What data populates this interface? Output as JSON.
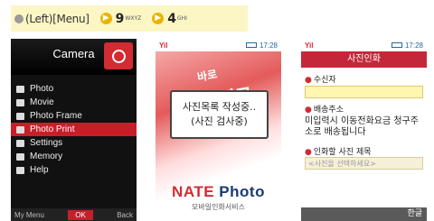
{
  "instruction": {
    "menu_hint": "(Left)[Menu]",
    "key1": "9",
    "key1_sub": "WXYZ",
    "key2": "4",
    "key2_sub": "GHI"
  },
  "camera_menu": {
    "title": "Camera",
    "items": [
      "Photo",
      "Movie",
      "Photo Frame",
      "Photo Print",
      "Settings",
      "Memory",
      "Help"
    ],
    "selected_index": 3,
    "soft_left": "My Menu",
    "soft_center": "OK",
    "soft_right": "Back"
  },
  "status": {
    "time": "17:28",
    "carrier_icon": "signal-icon"
  },
  "loading_screen": {
    "watermark1": "바로",
    "watermark2": "찍고",
    "message_line1": "사진목록 작성중..",
    "message_line2": "(사진 검사중)",
    "brand_main": "NATE",
    "brand_sub": "Photo",
    "brand_tagline": "모바일인화서비스"
  },
  "order_form": {
    "title": "사진인화",
    "recipient_label": "수신자",
    "address_label": "배송주소",
    "address_text": "미입력시 이동전화요금 청구주소로 배송됩니다",
    "photo_title_label": "인화할 사진 제목",
    "photo_title_placeholder": "<사진을 선택하세요>",
    "soft_right": "한글"
  },
  "colors": {
    "accent_red": "#c81e2a",
    "hint_bg": "#fbf6c4"
  }
}
